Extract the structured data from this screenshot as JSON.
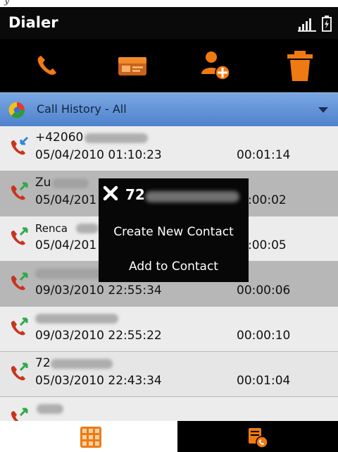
{
  "header": {
    "title": "Dialer"
  },
  "toolbar": {
    "buttons": [
      {
        "name": "call-icon"
      },
      {
        "name": "contacts-card-icon"
      },
      {
        "name": "add-contact-icon"
      },
      {
        "name": "trash-icon"
      }
    ]
  },
  "filter": {
    "label": "Call History - All"
  },
  "calls": [
    {
      "name": "+42060",
      "date": "05/04/2010 01:10:23",
      "duration": "00:01:14",
      "type": "incoming"
    },
    {
      "name": "Zu",
      "date": "05/04/201",
      "duration": ":00:02",
      "type": "outgoing"
    },
    {
      "name": "Renca",
      "date": "05/04/201",
      "duration": ":00:05",
      "type": "outgoing"
    },
    {
      "name": "",
      "date": "09/03/2010 22:55:34",
      "duration": "00:00:06",
      "type": "outgoing"
    },
    {
      "name": "",
      "date": "09/03/2010 22:55:22",
      "duration": "00:00:10",
      "type": "outgoing"
    },
    {
      "name": "72",
      "date": "05/03/2010 22:43:34",
      "duration": "00:01:04",
      "type": "outgoing"
    },
    {
      "name": "",
      "date": "",
      "duration": "",
      "type": "outgoing"
    }
  ],
  "popup": {
    "number": "72",
    "options": [
      "Create New Contact",
      "Add to Contact"
    ]
  },
  "bottom_nav": [
    {
      "name": "keypad-icon",
      "selected": false
    },
    {
      "name": "call-log-icon",
      "selected": true
    }
  ],
  "colors": {
    "filter_bar": "#5a8bd3",
    "accent_orange": "#f07a12",
    "row_light": "#ececec",
    "row_dark": "#b7b7b7"
  }
}
